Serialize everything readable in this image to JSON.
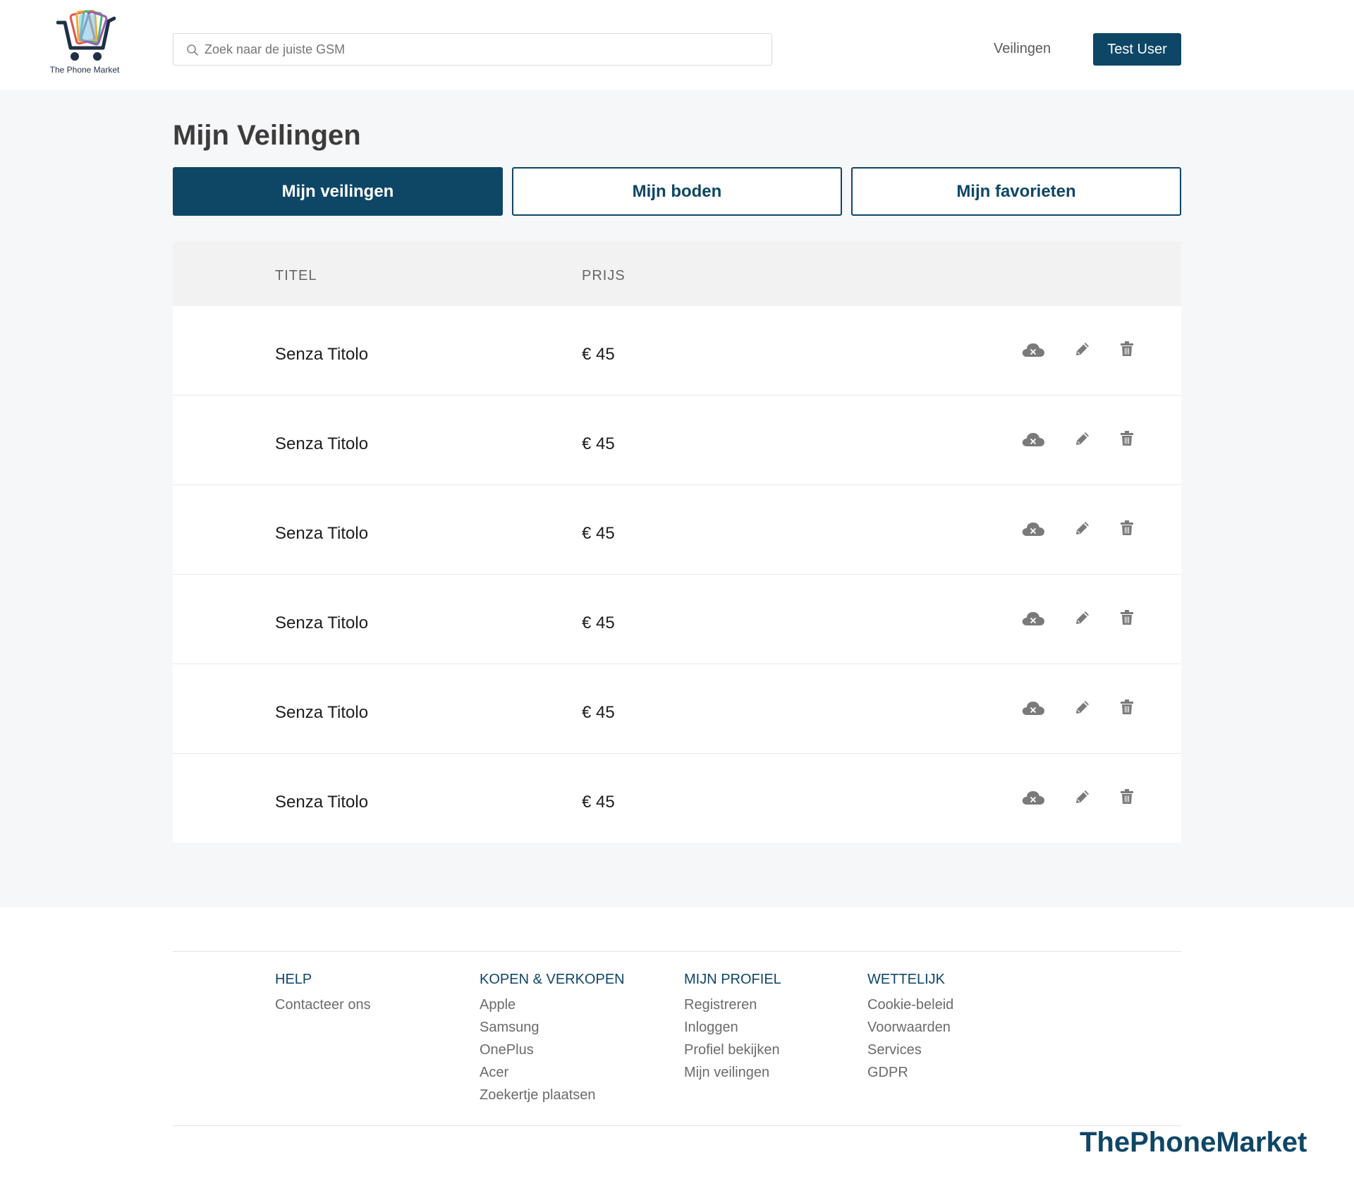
{
  "header": {
    "logo_text": "The Phone Market",
    "search_placeholder": "Zoek naar de juiste GSM",
    "nav_link": "Veilingen",
    "user_button": "Test User"
  },
  "main": {
    "title": "Mijn Veilingen",
    "tabs": [
      {
        "label": "Mijn veilingen",
        "active": true
      },
      {
        "label": "Mijn boden",
        "active": false
      },
      {
        "label": "Mijn favorieten",
        "active": false
      }
    ],
    "table": {
      "headers": {
        "title": "TITEL",
        "price": "PRIJS"
      },
      "rows": [
        {
          "title": "Senza Titolo",
          "price": "€ 45"
        },
        {
          "title": "Senza Titolo",
          "price": "€ 45"
        },
        {
          "title": "Senza Titolo",
          "price": "€ 45"
        },
        {
          "title": "Senza Titolo",
          "price": "€ 45"
        },
        {
          "title": "Senza Titolo",
          "price": "€ 45"
        },
        {
          "title": "Senza Titolo",
          "price": "€ 45"
        }
      ],
      "row_actions": [
        "cloud-offline-icon",
        "pencil-icon",
        "trash-icon"
      ]
    }
  },
  "footer": {
    "columns": [
      {
        "heading": "HELP",
        "links": [
          "Contacteer ons"
        ]
      },
      {
        "heading": "KOPEN & VERKOPEN",
        "links": [
          "Apple",
          "Samsung",
          "OnePlus",
          "Acer",
          "Zoekertje plaatsen"
        ]
      },
      {
        "heading": "MIJN PROFIEL",
        "links": [
          "Registreren",
          "Inloggen",
          "Profiel bekijken",
          "Mijn veilingen"
        ]
      },
      {
        "heading": "WETTELIJK",
        "links": [
          "Cookie-beleid",
          "Voorwaarden",
          "Services",
          "GDPR"
        ]
      }
    ],
    "brand": "ThePhoneMarket"
  },
  "colors": {
    "primary": "#0e4666",
    "page_background": "#f6f7f9",
    "table_header_background": "#f2f2f2",
    "icon_gray": "#7a7a7a"
  }
}
